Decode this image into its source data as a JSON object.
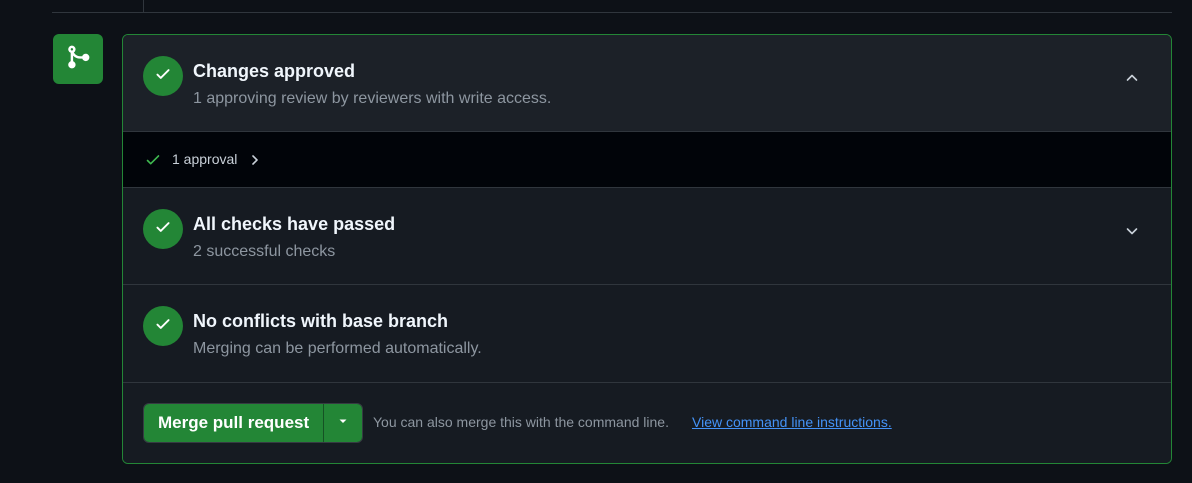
{
  "colors": {
    "success": "#238636",
    "link": "#4493f8",
    "muted": "#8d96a0",
    "background": "#0d1117"
  },
  "merge_icon": "git-merge-icon",
  "sections": {
    "approved": {
      "title": "Changes approved",
      "subtitle": "1 approving review by reviewers with write access.",
      "icon": "check-icon",
      "toggle_icon": "chevron-up-icon"
    },
    "approval_row": {
      "label": "1 approval",
      "icon": "check-icon",
      "arrow_icon": "chevron-right-icon"
    },
    "checks": {
      "title": "All checks have passed",
      "subtitle": "2 successful checks",
      "icon": "check-icon",
      "toggle_icon": "chevron-down-icon"
    },
    "conflicts": {
      "title": "No conflicts with base branch",
      "subtitle": "Merging can be performed automatically.",
      "icon": "check-icon"
    }
  },
  "merge": {
    "button_label": "Merge pull request",
    "dropdown_icon": "caret-down-icon",
    "hint": "You can also merge this with the command line.",
    "link": "View command line instructions."
  }
}
